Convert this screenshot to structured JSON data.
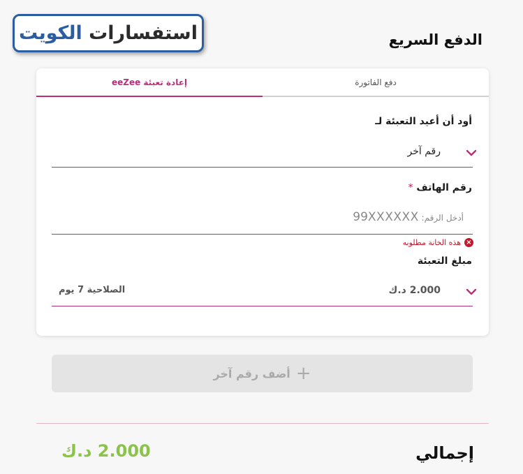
{
  "watermark": {
    "part1": "استفسارات",
    "part2": "الكويت"
  },
  "page": {
    "title": "الدفع السريع"
  },
  "tabs": [
    {
      "label": "دفع الفاتورة",
      "active": false
    },
    {
      "label": "إعادة تعبئة eeZee",
      "active": true
    }
  ],
  "refill_for": {
    "label": "أود أن أعيد التعبئة لـ",
    "value": "رقم آخر"
  },
  "phone": {
    "label": "رقم الهاتف",
    "required_mark": "*",
    "placeholder_prefix": "أدخل الرقم:",
    "placeholder_number": "99XXXXXX",
    "value": "",
    "error": "هذه الخانة مطلوبه"
  },
  "amount": {
    "label": "مبلغ التعبئة",
    "value": "2.000 د.ك",
    "validity": "الصلاحية 7 يوم"
  },
  "add_number": {
    "label": "أضف رقم آخر",
    "icon": "plus-icon"
  },
  "total": {
    "label": "إجمالي",
    "value": "2.000 د.ك"
  },
  "colors": {
    "accent": "#b6317a",
    "error": "#c0182d",
    "total": "#8bc34a",
    "watermark_blue": "#2a5ea0"
  }
}
